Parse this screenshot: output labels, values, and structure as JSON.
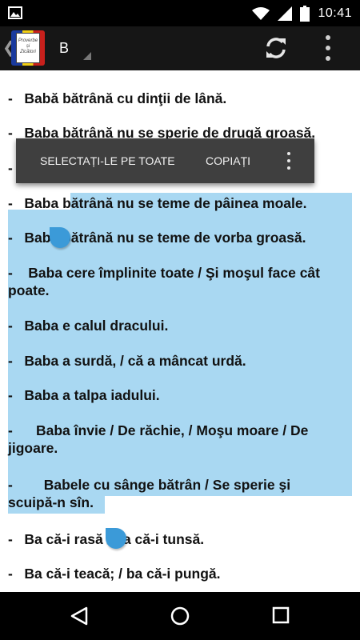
{
  "status_bar": {
    "time": "10:41",
    "icons": [
      "image-icon",
      "wifi-icon",
      "signal-icon",
      "battery-icon"
    ]
  },
  "action_bar": {
    "title": "B",
    "logo_text": [
      "Proverbe",
      "și",
      "Zicători"
    ],
    "icons": [
      "back-chevron-icon",
      "app-logo",
      "refresh-icon",
      "overflow-menu-icon"
    ]
  },
  "context_menu": {
    "select_all": "SELECTAȚI-LE PE TOATE",
    "copy": "COPIAȚI",
    "more_icon": "overflow-menu-icon"
  },
  "content": {
    "lines": [
      "-   Babă bătrână cu dinţii de lână.",
      "-   Baba bătrână nu se sperie de drugă groasă.",
      "-",
      "-   Baba bătrână nu se teme de pâinea moale.",
      "-   Baba bătrână nu se teme de vorba groasă.",
      "-    Baba cere împlinite toate / Şi moşul face cât",
      "poate.",
      "-   Baba e calul dracului.",
      "-   Baba a surdă, / că a mâncat urdă.",
      "-   Baba a talpa iadului.",
      "-      Baba învie / De răchie, / Moşu moare / De",
      "jigoare.",
      "-        Babele cu sânge bătrân / Se sperie şi",
      "scuipă-n sîn.",
      "-   Ba că-i rasă / ba că-i tunsă.",
      "-   Ba că-i teacă; / ba că-i pungă."
    ]
  },
  "colors": {
    "status_bar": "#000000",
    "action_bar": "#161616",
    "selection_highlight": "#a9d8f2",
    "selection_handle": "#3b9ad8",
    "popup": "#3f3f3f",
    "nav_bar": "#000000"
  },
  "nav_bar": {
    "icons": [
      "back-triangle-icon",
      "home-circle-icon",
      "recents-square-icon"
    ]
  }
}
